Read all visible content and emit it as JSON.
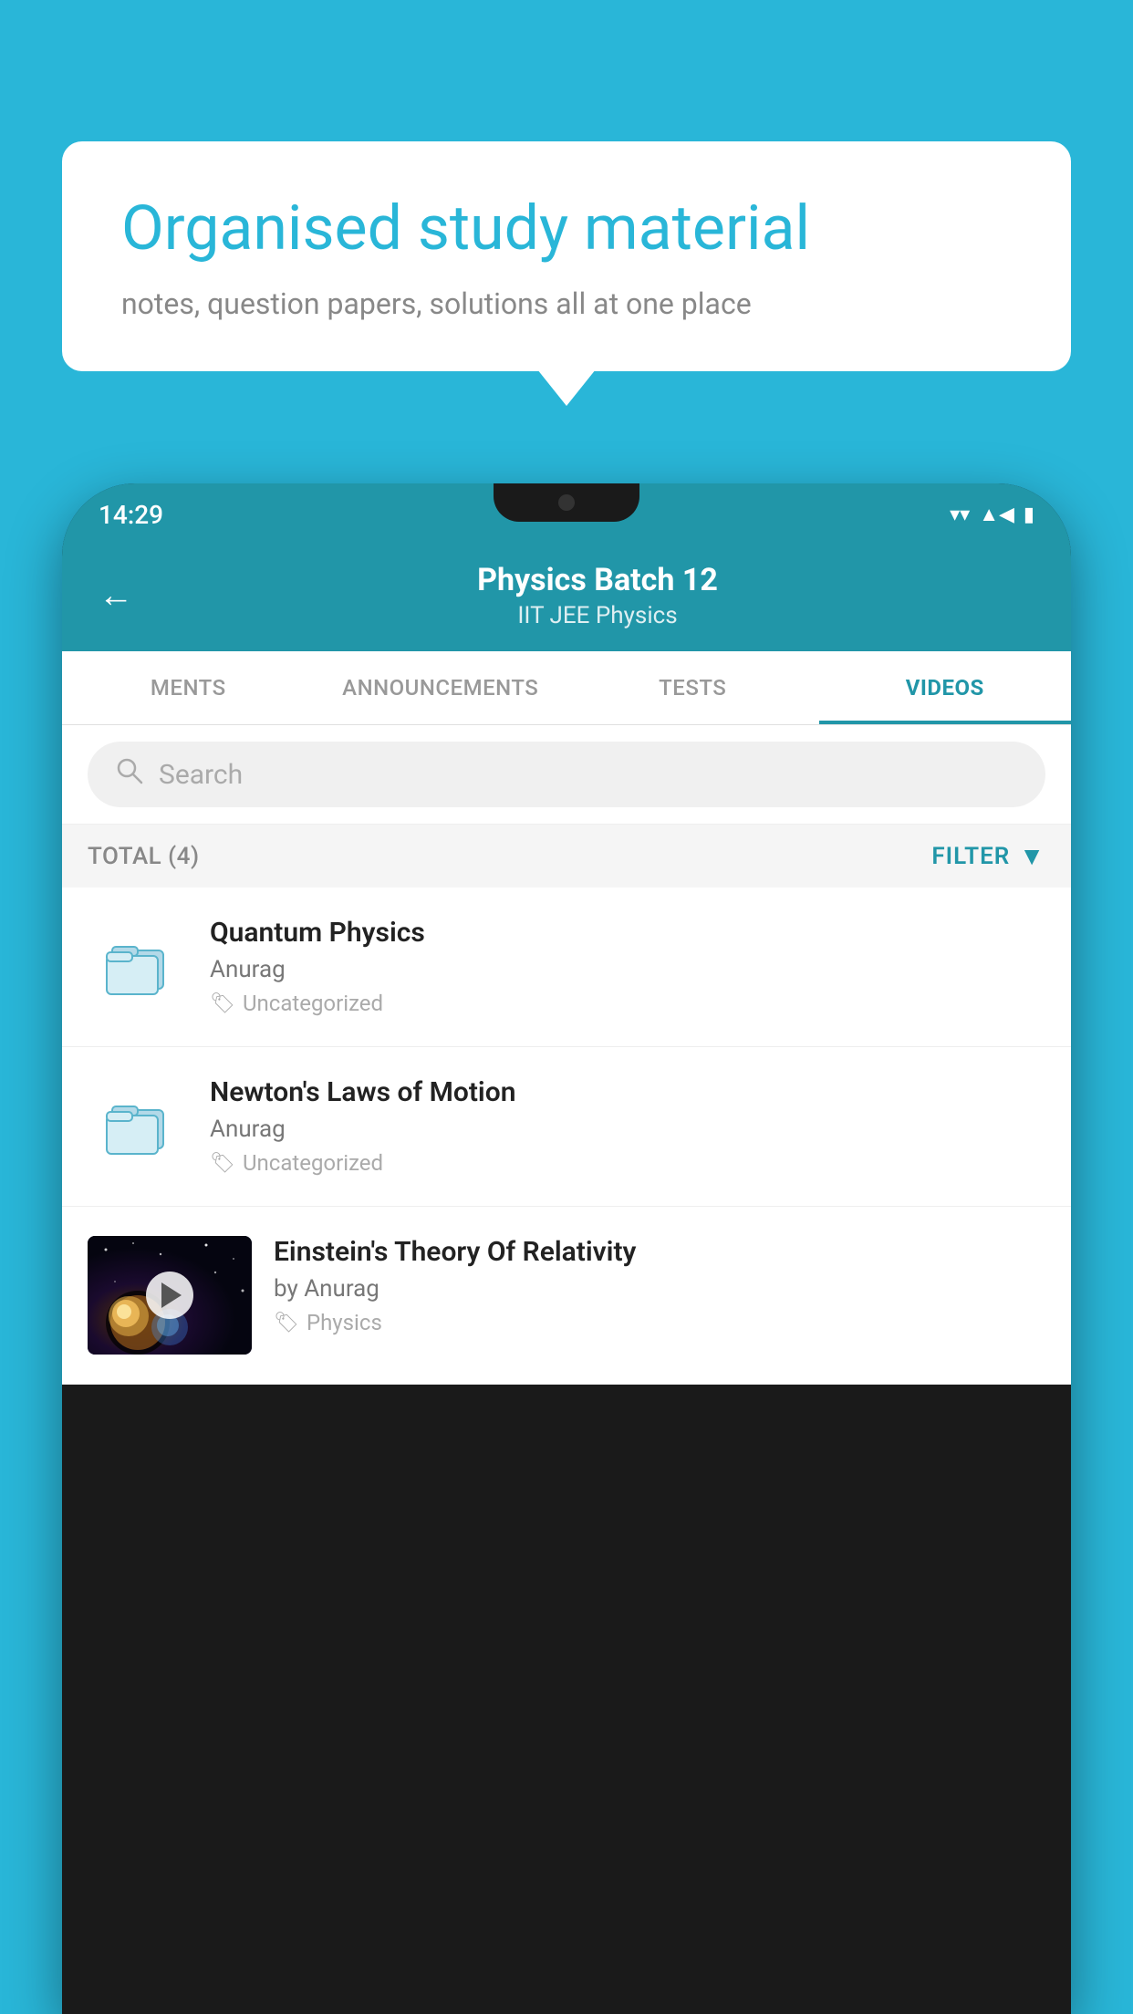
{
  "app": {
    "background_color": "#29b6d8"
  },
  "speech_bubble": {
    "heading": "Organised study material",
    "subtext": "notes, question papers, solutions all at one place"
  },
  "phone": {
    "status_bar": {
      "time": "14:29",
      "wifi": "▼",
      "signal": "▲",
      "battery": "▮"
    },
    "header": {
      "back_label": "←",
      "title": "Physics Batch 12",
      "subtitle": "IIT JEE   Physics"
    },
    "tabs": [
      {
        "label": "MENTS",
        "active": false
      },
      {
        "label": "ANNOUNCEMENTS",
        "active": false
      },
      {
        "label": "TESTS",
        "active": false
      },
      {
        "label": "VIDEOS",
        "active": true
      }
    ],
    "search": {
      "placeholder": "Search"
    },
    "filter_bar": {
      "total_label": "TOTAL (4)",
      "filter_label": "FILTER"
    },
    "videos": [
      {
        "id": 1,
        "title": "Quantum Physics",
        "author": "Anurag",
        "tag": "Uncategorized",
        "has_thumbnail": false
      },
      {
        "id": 2,
        "title": "Newton's Laws of Motion",
        "author": "Anurag",
        "tag": "Uncategorized",
        "has_thumbnail": false
      },
      {
        "id": 3,
        "title": "Einstein's Theory Of Relativity",
        "author": "by Anurag",
        "tag": "Physics",
        "has_thumbnail": true
      }
    ]
  }
}
